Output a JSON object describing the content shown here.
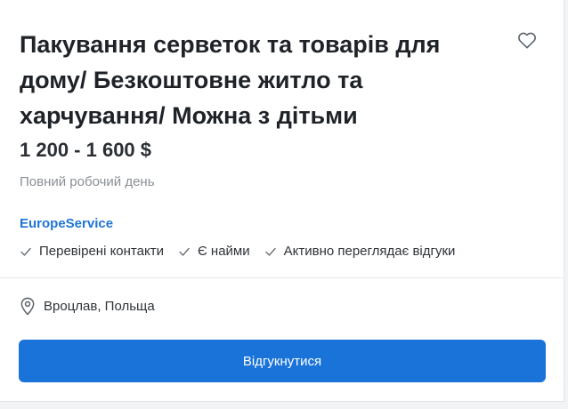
{
  "job": {
    "title": "Пакування серветок та товарів для дому/ Безкоштовне житло та харчування/ Можна з дітьми",
    "salary": "1 200 - 1 600 $",
    "work_type": "Повний робочий день",
    "company": "EuropeService",
    "badges": [
      {
        "label": "Перевірені контакти",
        "icon": "check-icon"
      },
      {
        "label": "Є найми",
        "icon": "check-icon"
      },
      {
        "label": "Активно переглядає відгуки",
        "icon": "check-icon"
      }
    ],
    "location": "Вроцлав, Польща",
    "apply_label": "Відгукнутися"
  },
  "icons": {
    "favorite": "heart-icon",
    "location": "map-pin-icon"
  },
  "colors": {
    "accent": "#1a73d9",
    "link": "#1f74d6",
    "muted_text": "#8a8f96",
    "title_text": "#1f2328"
  }
}
